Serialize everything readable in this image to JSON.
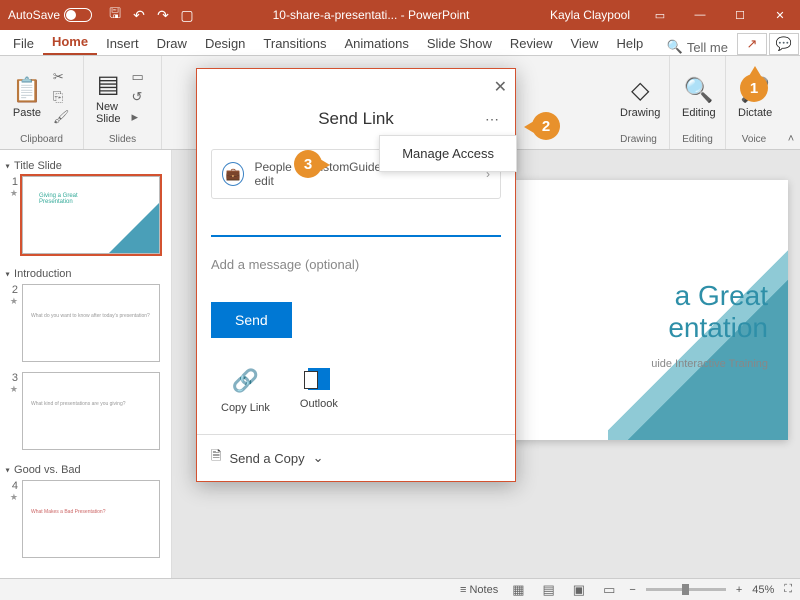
{
  "titlebar": {
    "autosave": "AutoSave",
    "filename": "10-share-a-presentati...",
    "app": "PowerPoint",
    "user": "Kayla Claypool"
  },
  "tabs": {
    "file": "File",
    "home": "Home",
    "insert": "Insert",
    "draw": "Draw",
    "design": "Design",
    "transitions": "Transitions",
    "animations": "Animations",
    "slideshow": "Slide Show",
    "review": "Review",
    "view": "View",
    "help": "Help",
    "tellme": "Tell me"
  },
  "ribbon": {
    "clipboard": {
      "label": "Clipboard",
      "paste": "Paste"
    },
    "slides": {
      "label": "Slides",
      "new": "New\nSlide"
    },
    "drawing": {
      "label": "Drawing",
      "btn": "Drawing"
    },
    "editing": {
      "label": "Editing",
      "btn": "Editing"
    },
    "voice": {
      "label": "Voice",
      "btn": "Dictate"
    }
  },
  "sections": [
    "Title Slide",
    "Introduction",
    "Good vs. Bad"
  ],
  "thumbs": [
    {
      "n": "1",
      "t1": "Giving a Great",
      "t2": "Presentation"
    },
    {
      "n": "2",
      "g": "What do you want to know after today's presentation?"
    },
    {
      "n": "3",
      "g": "What kind of presentations are you giving?"
    },
    {
      "n": "4",
      "g": "What Makes a Bad Presentation?"
    }
  ],
  "slide": {
    "title1": "a Great",
    "title2": "entation",
    "sub": "uide Interactive Training"
  },
  "dialog": {
    "title": "Send Link",
    "manage": "Manage Access",
    "perm": "People in CustomGuide with the link can edit",
    "msg_placeholder": "Add a message (optional)",
    "send": "Send",
    "copy": "Copy Link",
    "outlook": "Outlook",
    "sendcopy": "Send a Copy"
  },
  "status": {
    "notes": "Notes",
    "zoom": "45%"
  },
  "callouts": {
    "1": "1",
    "2": "2",
    "3": "3"
  }
}
